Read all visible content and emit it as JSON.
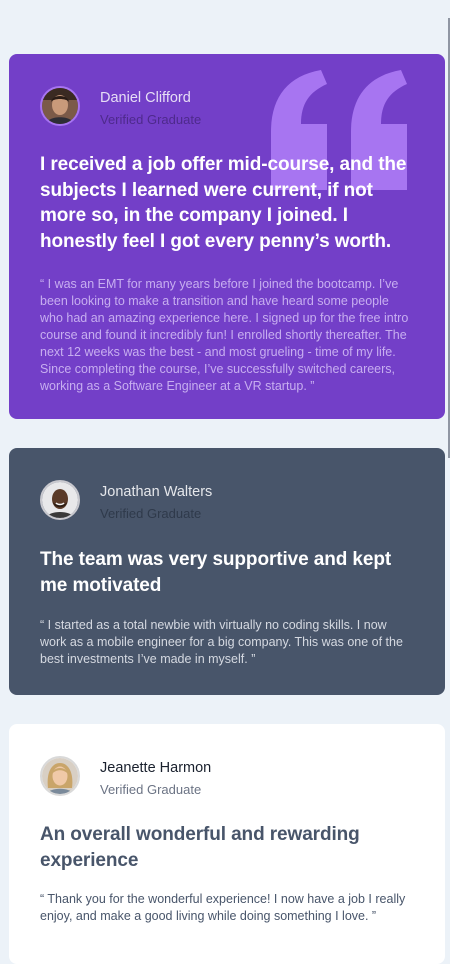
{
  "testimonials": [
    {
      "name": "Daniel Clifford",
      "role": "Verified Graduate",
      "headline": "I received a job offer mid-course, and the subjects I learned were current, if not more so, in the company I joined. I honestly feel I got every penny’s worth.",
      "body": "“ I was an EMT for many years before I joined the bootcamp. I’ve been looking to make a transition and have heard some people who had an amazing experience here. I signed up for the free intro course and found it incredibly fun! I enrolled shortly thereafter. The next 12 weeks was the best - and most grueling - time of my life. Since completing the course, I’ve successfully switched careers, working as a Software Engineer at a VR startup. ”",
      "background": "#733FC8",
      "avatar_icon": "person-avatar"
    },
    {
      "name": "Jonathan Walters",
      "role": "Verified Graduate",
      "headline": "The team was very supportive and kept me motivated",
      "body": "“ I started as a total newbie with virtually no coding skills. I now work as a mobile engineer for a big company. This was one of the best investments I’ve made in myself. ”",
      "background": "#48556A",
      "avatar_icon": "person-avatar"
    },
    {
      "name": "Jeanette Harmon",
      "role": "Verified Graduate",
      "headline": "An overall wonderful and rewarding experience",
      "body": "“ Thank you for the wonderful experience! I now have a job I really enjoy, and make a good living while doing something I love. ”",
      "background": "#FFFFFF",
      "avatar_icon": "person-avatar"
    }
  ],
  "colors": {
    "page_background": "#ECF2F8",
    "quote_mark": "#A775F1"
  }
}
